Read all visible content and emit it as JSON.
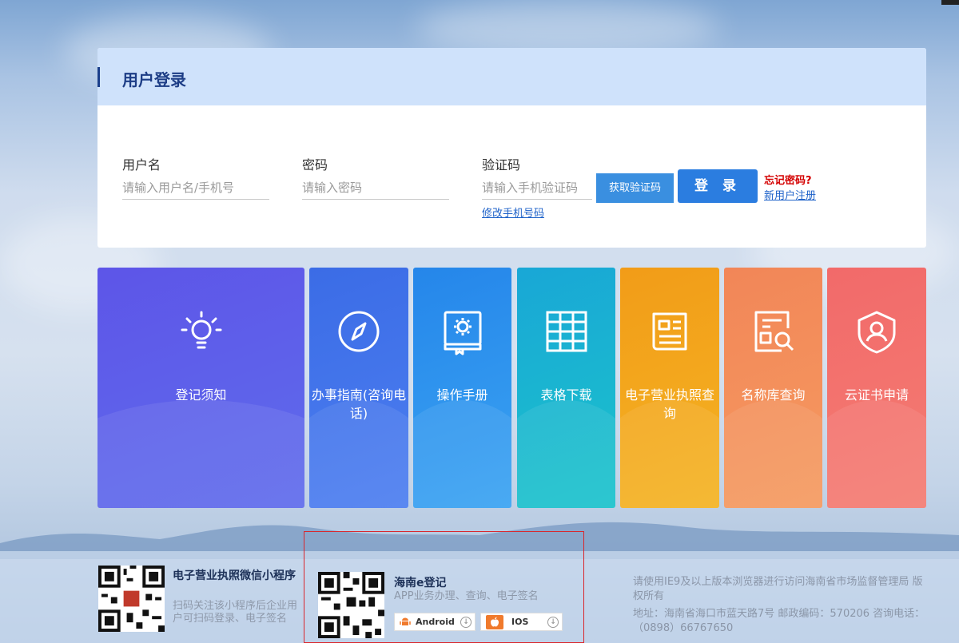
{
  "login": {
    "title": "用户登录",
    "username_label": "用户名",
    "username_placeholder": "请输入用户名/手机号",
    "password_label": "密码",
    "password_placeholder": "请输入密码",
    "code_label": "验证码",
    "code_placeholder": "请输入手机验证码",
    "get_code_label": "获取验证码",
    "login_label": "登 录",
    "forgot_label": "忘记密码?",
    "register_label": "新用户注册",
    "change_phone_label": "修改手机号码"
  },
  "tiles": [
    {
      "label": "登记须知",
      "icon": "lightbulb-icon",
      "color": "#5b63e6"
    },
    {
      "label": "办事指南(咨询电话)",
      "icon": "compass-icon",
      "color": "#3f6fe8"
    },
    {
      "label": "操作手册",
      "icon": "manual-gear-icon",
      "color": "#2e8fee"
    },
    {
      "label": "表格下载",
      "icon": "table-icon",
      "color": "#1bb7cf"
    },
    {
      "label": "电子营业执照查询",
      "icon": "document-icon",
      "color": "#f2a81c"
    },
    {
      "label": "名称库查询",
      "icon": "search-document-icon",
      "color": "#f38b5a"
    },
    {
      "label": "云证书申请",
      "icon": "user-shield-icon",
      "color": "#f26f6f"
    }
  ],
  "footer": {
    "wechat_title": "电子营业执照微信小程序",
    "wechat_desc": "扫码关注该小程序后企业用户可扫码登录、电子签名",
    "app_title": "海南e登记",
    "app_desc": "APP业务办理、查询、电子签名",
    "android_label": "Android",
    "ios_label": "IOS",
    "copyright_line1": "请使用IE9及以上版本浏览器进行访问海南省市场监督管理局 版权所有",
    "address": "地址：海南省海口市蓝天路7号 邮政编码：570206 咨询电话：（0898）66767650"
  }
}
